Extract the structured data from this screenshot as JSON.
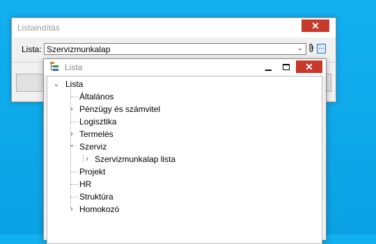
{
  "outer_dialog": {
    "title": "Listaindítás",
    "close_label": "✕",
    "list_label": "Lista:",
    "list_value": "Szervizmunkalap"
  },
  "icons": {
    "combo_arrow": "chevron-down-icon",
    "attach": "paperclip-icon",
    "browse": "ellipsis-icon"
  },
  "popup": {
    "title": "Lista",
    "minimize_label": "▁",
    "close_label": "✕"
  },
  "tree": {
    "root": "Lista",
    "items": [
      {
        "label": "Általános",
        "expander": ""
      },
      {
        "label": "Pénzügy és számvitel",
        "expander": "›"
      },
      {
        "label": "Logisztika",
        "expander": ""
      },
      {
        "label": "Termelés",
        "expander": "›"
      },
      {
        "label": "Szerviz",
        "expander": "⌄"
      },
      {
        "label": "Szervizmunkalap lista",
        "expander": "›"
      },
      {
        "label": "Projekt",
        "expander": ""
      },
      {
        "label": "HR",
        "expander": ""
      },
      {
        "label": "Struktúra",
        "expander": ""
      },
      {
        "label": "Homokozó",
        "expander": "›"
      }
    ]
  },
  "colors": {
    "close": "#c7392b",
    "desktop": "#0aa2e4"
  }
}
